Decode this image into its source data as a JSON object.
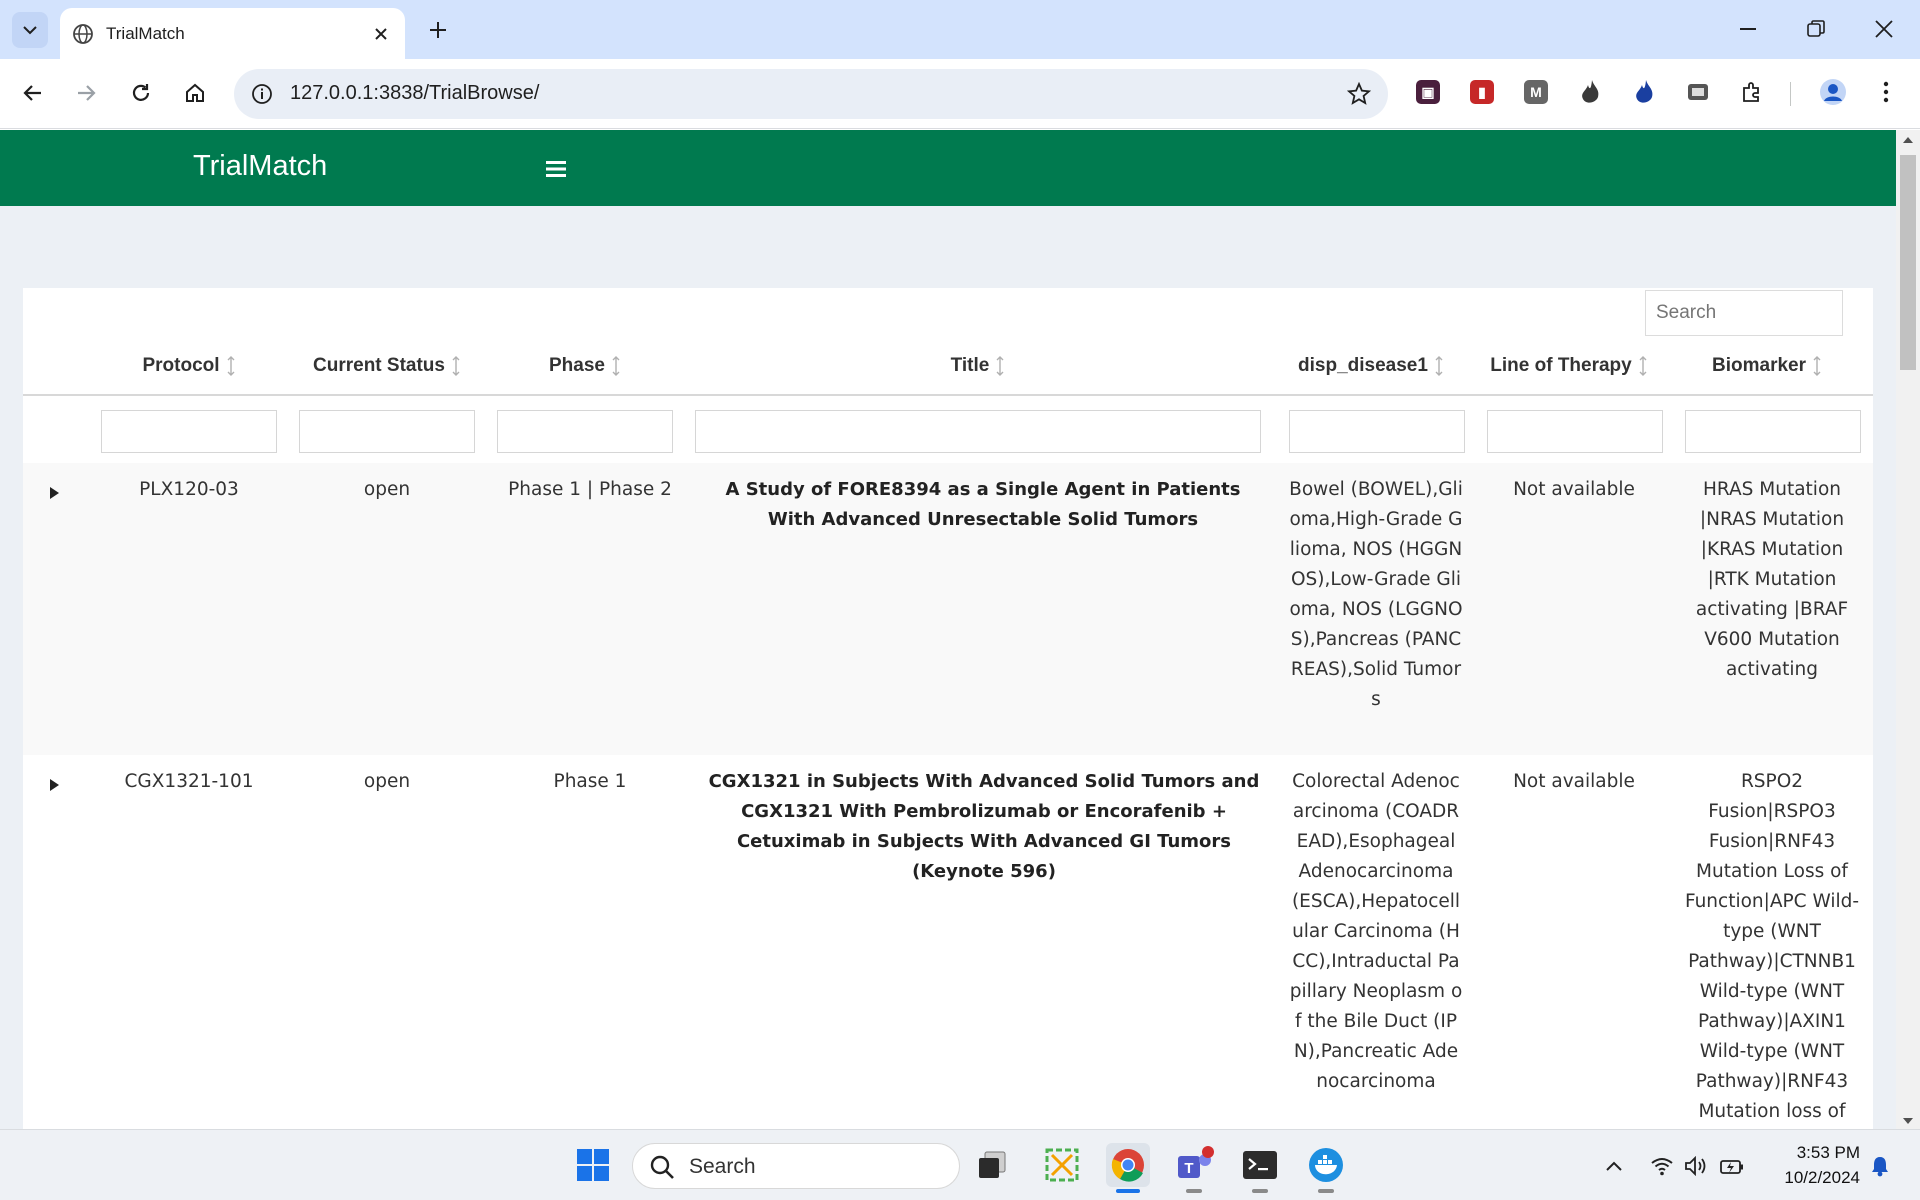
{
  "browser": {
    "tab_title": "TrialMatch",
    "url": "127.0.0.1:3838/TrialBrowse/"
  },
  "app": {
    "brand": "TrialMatch",
    "search_placeholder": "Search",
    "accent_color": "#007a4f"
  },
  "table": {
    "columns": [
      "Protocol",
      "Current Status",
      "Phase",
      "Title",
      "disp_disease1",
      "Line of Therapy",
      "Biomarker"
    ],
    "rows": [
      {
        "protocol": "PLX120-03",
        "status": "open",
        "phase": "Phase 1 | Phase 2",
        "title": "A Study of FORE8394 as a Single Agent in Patients With Advanced Unresectable Solid Tumors",
        "disease": "Bowel (BOWEL),Glioma,High-Grade Glioma, NOS (HGGNOS),Low-Grade Glioma, NOS (LGGNOS),Pancreas (PANCREAS),Solid Tumors",
        "line_of_therapy": "Not available",
        "biomarker": "HRAS Mutation |NRAS Mutation |KRAS Mutation |RTK Mutation activating |BRAF V600 Mutation activating"
      },
      {
        "protocol": "CGX1321-101",
        "status": "open",
        "phase": "Phase 1",
        "title": "CGX1321 in Subjects With Advanced Solid Tumors and CGX1321 With Pembrolizumab or Encorafenib + Cetuximab in Subjects With Advanced GI Tumors (Keynote 596)",
        "disease": "Colorectal Adenocarcinoma (COADREAD),Esophageal Adenocarcinoma (ESCA),Hepatocellular Carcinoma (HCC),Intraductal Papillary Neoplasm of the Bile Duct (IPN),Pancreatic Adenocarcinoma",
        "line_of_therapy": "Not available",
        "biomarker": "RSPO2 Fusion|RSPO3 Fusion|RNF43 Mutation Loss of Function|APC Wild-type (WNT Pathway)|CTNNB1 Wild-type (WNT Pathway)|AXIN1 Wild-type (WNT Pathway)|RNF43 Mutation loss of"
      }
    ]
  },
  "taskbar": {
    "search_label": "Search",
    "time": "3:53 PM",
    "date": "10/2/2024"
  }
}
